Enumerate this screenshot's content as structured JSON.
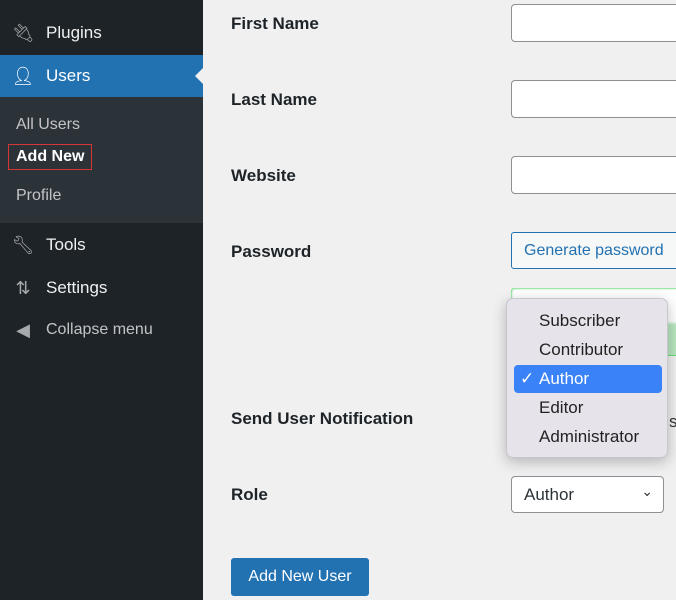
{
  "sidebar": {
    "items": [
      {
        "label": "Plugins",
        "icon": "plugin-icon"
      },
      {
        "label": "Users",
        "icon": "user-icon"
      },
      {
        "label": "Tools",
        "icon": "wrench-icon"
      },
      {
        "label": "Settings",
        "icon": "settings-icon"
      },
      {
        "label": "Collapse menu",
        "icon": "collapse-icon"
      }
    ],
    "submenu": [
      "All Users",
      "Add New",
      "Profile"
    ],
    "accent": "#2271b1"
  },
  "form": {
    "first_name": "First Name",
    "last_name": "Last Name",
    "website": "Website",
    "password": "Password",
    "generate_password": "Generate password",
    "send_notification": "Send User Notification",
    "role": "Role",
    "role_value": "Author",
    "submit": "Add New User"
  },
  "dropdown": {
    "options": [
      "Subscriber",
      "Contributor",
      "Author",
      "Editor",
      "Administrator"
    ],
    "selected": "Author",
    "check": "✓"
  }
}
